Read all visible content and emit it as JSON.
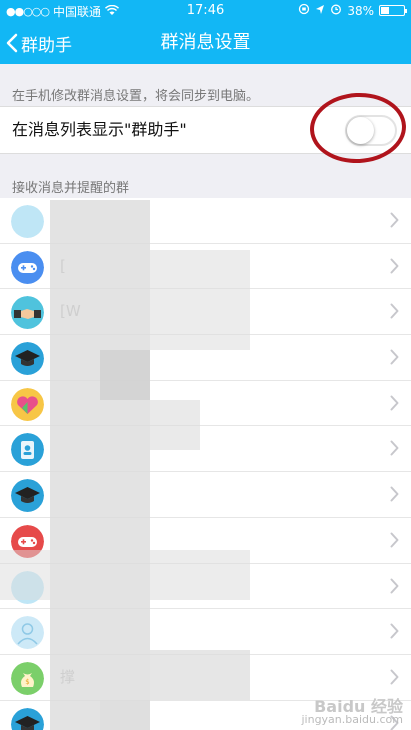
{
  "status": {
    "carrier": "中国联通",
    "time": "17:46",
    "battery": "38%",
    "battery_level": 0.38
  },
  "nav": {
    "back_label": "群助手",
    "title": "群消息设置"
  },
  "settings": {
    "sync_hint": "在手机修改群消息设置，将会同步到电脑。",
    "show_in_list_label": "在消息列表显示\"群助手\"",
    "show_in_list_on": false
  },
  "groups": {
    "section_title": "接收消息并提醒的群",
    "items": [
      {
        "avatar": "blurred-icon",
        "name": ""
      },
      {
        "avatar": "gamepad-icon",
        "name": "["
      },
      {
        "avatar": "handshake-icon",
        "name": "[W"
      },
      {
        "avatar": "graduation-cap-icon",
        "name": ""
      },
      {
        "avatar": "heart-icon",
        "name": ""
      },
      {
        "avatar": "id-badge-icon",
        "name": ""
      },
      {
        "avatar": "graduation-cap-icon",
        "name": ""
      },
      {
        "avatar": "gamepad-icon",
        "name": ""
      },
      {
        "avatar": "blurred-icon",
        "name": ""
      },
      {
        "avatar": "user-icon",
        "name": ""
      },
      {
        "avatar": "money-bag-icon",
        "name": "撑"
      },
      {
        "avatar": "graduation-cap-icon",
        "name": ""
      }
    ]
  },
  "watermark": {
    "brand": "Baidu 经验",
    "url": "jingyan.baidu.com"
  },
  "colors": {
    "accent": "#12b7f5",
    "annotation": "#b0141c"
  }
}
